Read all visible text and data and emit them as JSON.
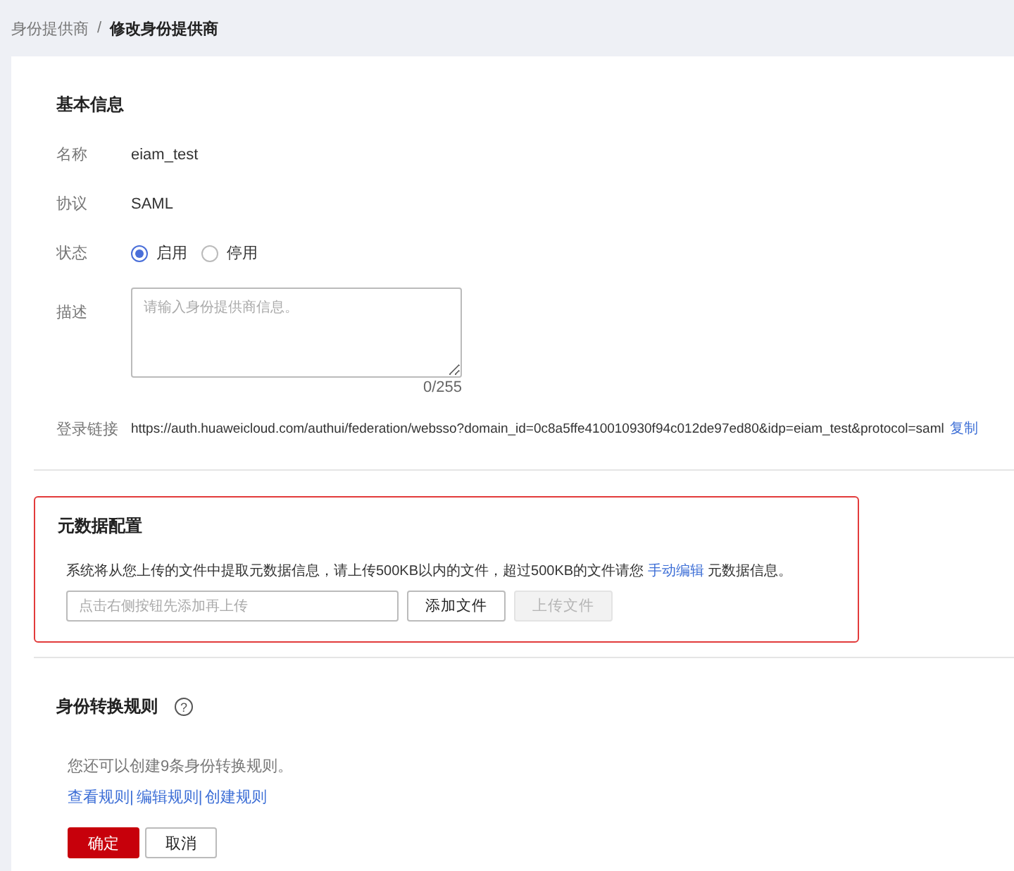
{
  "breadcrumb": {
    "separator": "/",
    "items": [
      {
        "label": "身份提供商",
        "current": false
      },
      {
        "label": "修改身份提供商",
        "current": true
      }
    ]
  },
  "basic_info": {
    "title": "基本信息",
    "fields": [
      {
        "kind": "text",
        "label": "名称",
        "value": "eiam_test"
      },
      {
        "kind": "text",
        "label": "协议",
        "value": "SAML"
      },
      {
        "kind": "radio",
        "label": "状态",
        "options": [
          {
            "label": "启用",
            "selected": true
          },
          {
            "label": "停用",
            "selected": false
          }
        ]
      },
      {
        "kind": "textarea",
        "label": "描述",
        "placeholder": "请输入身份提供商信息。",
        "counter": "0/255"
      },
      {
        "kind": "link",
        "label": "登录链接",
        "value": "https://auth.huaweicloud.com/authui/federation/websso?domain_id=0c8a5ffe410010930f94c012de97ed80&idp=eiam_test&protocol=saml",
        "action": "复制"
      }
    ]
  },
  "metadata": {
    "title": "元数据配置",
    "highlighted": true,
    "description_before": "系统将从您上传的文件中提取元数据信息，请上传500KB以内的文件，超过500KB的文件请您",
    "link": "手动编辑",
    "description_after": "元数据信息。",
    "file_placeholder": "点击右侧按钮先添加再上传",
    "buttons": [
      {
        "label": "添加文件",
        "disabled": false
      },
      {
        "label": "上传文件",
        "disabled": true
      }
    ]
  },
  "mapping_rules": {
    "title": "身份转换规则",
    "help": "?",
    "note": "您还可以创建9条身份转换规则。",
    "links": [
      "查看规则|",
      "编辑规则|",
      "创建规则"
    ]
  },
  "actions": [
    {
      "label": "确定",
      "kind": "primary"
    },
    {
      "label": "取消",
      "kind": "secondary"
    }
  ]
}
